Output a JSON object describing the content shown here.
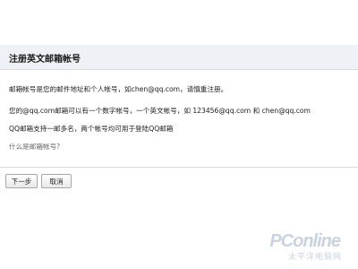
{
  "header": {
    "title": "注册英文邮箱帐号"
  },
  "content": {
    "line1": "邮箱帐号是您的邮件地址和个人帐号，如chen@qq.com，请慎重注册。",
    "line2": "您的@qq.com邮箱可以有一个数字帐号，一个英文帐号，如 123456@qq.com 和 chen@qq.com",
    "line3": "QQ邮箱支持一邮多名，两个帐号均可用于登陆QQ邮箱",
    "help_link": "什么是邮箱帐号?"
  },
  "buttons": {
    "next": "下一步",
    "cancel": "取消"
  },
  "watermark": {
    "brand": "PConline",
    "tagline": "太平洋电脑网"
  }
}
